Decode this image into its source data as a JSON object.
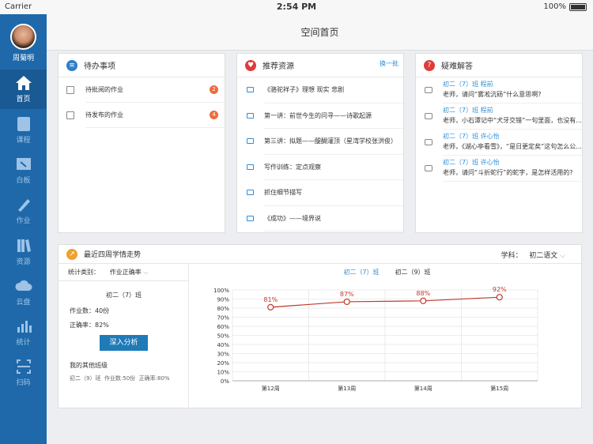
{
  "status": {
    "carrier": "Carrier",
    "time": "2:54 PM",
    "battery": "100%"
  },
  "user": {
    "name": "周菊明"
  },
  "nav": [
    {
      "label": "首页"
    },
    {
      "label": "课程"
    },
    {
      "label": "白板"
    },
    {
      "label": "作业"
    },
    {
      "label": "资源"
    },
    {
      "label": "云盘"
    },
    {
      "label": "统计"
    },
    {
      "label": "扫码"
    }
  ],
  "header": {
    "title": "空间首页"
  },
  "todo": {
    "title": "待办事项",
    "items": [
      {
        "label": "待批阅的作业",
        "count": "2"
      },
      {
        "label": "待发布的作业",
        "count": "4"
      }
    ]
  },
  "recommend": {
    "title": "推荐资源",
    "refresh": "换一批",
    "items": [
      "《骆驼祥子》理想 现实 悲剧",
      "第一讲：前世今生的问寻——诗歌起源",
      "第三讲：拟题——醍醐灌顶（星湾学校张洪俊）",
      "写作训练：定点观察",
      "抓住细节描写",
      "《成功》——境界说"
    ]
  },
  "qa": {
    "title": "疑难解答",
    "items": [
      {
        "cls": "初二（7）班 程前",
        "q": "老师，请问“雾凇沆砀”什么意思啊?"
      },
      {
        "cls": "初二（7）班 程前",
        "q": "老师，小石潭记中“犬牙交错”一句里面，也没有..."
      },
      {
        "cls": "初二（7）班 许心怡",
        "q": "老师，《湖心亭看雪》，“是日更定矣”这句怎么公..."
      },
      {
        "cls": "初二（7）班 许心怡",
        "q": "老师，请问“斗折蛇行”的蛇字，是怎样活用的?"
      }
    ]
  },
  "trend": {
    "title": "最近四周学情走势",
    "subject_label": "学科：",
    "subject_value": "初二语文",
    "category_label": "统计类别：",
    "category_value": "作业正确率",
    "class_name": "初二（7）班",
    "homework": "作业数：40份",
    "accuracy": "正确率：82%",
    "analyze_button": "深入分析",
    "other_title": "我的其他班级",
    "other_class": "初二（9）班",
    "other_homework": "作业数:50份",
    "other_accuracy": "正确率:80%"
  },
  "chart_data": {
    "type": "line",
    "x": [
      "第12周",
      "第13周",
      "第14周",
      "第15周"
    ],
    "series": [
      {
        "name": "初二（7）班",
        "values": [
          81,
          87,
          88,
          92
        ]
      }
    ],
    "legend": [
      "初二（7）班",
      "初二（9）班"
    ],
    "data_labels": [
      "81%",
      "87%",
      "88%",
      "92%"
    ],
    "yticks": [
      "100%",
      "90%",
      "80%",
      "70%",
      "60%",
      "50%",
      "40%",
      "30%",
      "20%",
      "10%",
      "0%"
    ],
    "ylim": [
      0,
      100
    ],
    "color": "#c0392b"
  }
}
